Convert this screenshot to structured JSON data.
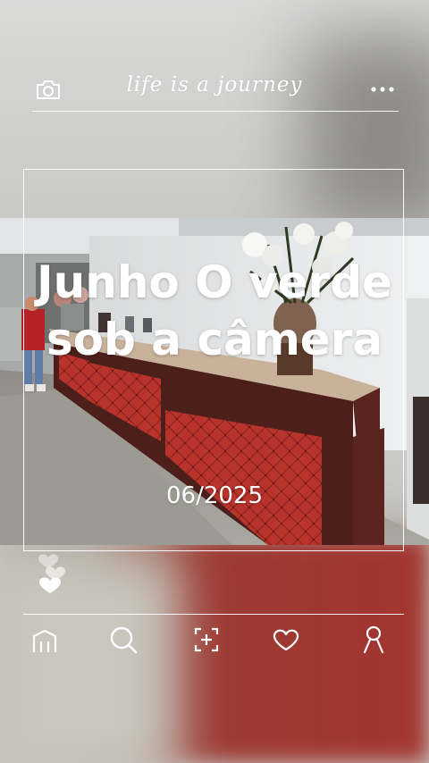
{
  "header": {
    "title": "life is a journey",
    "camera_icon": "camera-icon",
    "more_icon": "more-dots-icon"
  },
  "post": {
    "title": "Junho O verde sob a câmera",
    "date": "06/2025"
  },
  "nav": {
    "items": [
      {
        "icon": "home-icon"
      },
      {
        "icon": "search-icon"
      },
      {
        "icon": "add-post-icon"
      },
      {
        "icon": "heart-icon"
      },
      {
        "icon": "profile-icon"
      }
    ]
  },
  "colors": {
    "overlay_text": "#ffffff",
    "counter_red": "#a3352f",
    "counter_wood": "#5a2520"
  }
}
